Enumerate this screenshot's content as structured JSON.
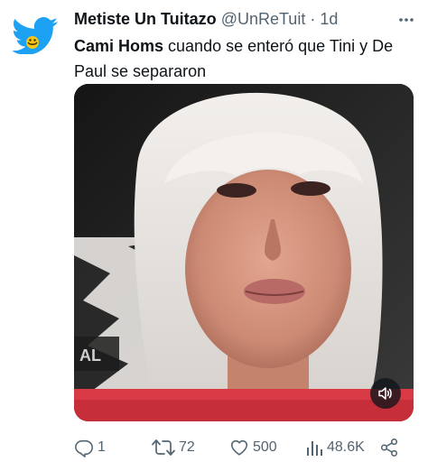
{
  "tweet": {
    "author_name": "Metiste Un Tuitazo",
    "handle": "@UnReTuit",
    "separator": "·",
    "time": "1d",
    "text_bold": "Cami Homs",
    "text_rest": " cuando se enteró que Tini y De Paul se separaron"
  },
  "media": {
    "type": "video"
  },
  "metrics": {
    "replies": "1",
    "retweets": "72",
    "likes": "500",
    "views": "48.6K"
  },
  "icons": {
    "avatar": "twitter-bird-avatar",
    "more": "more-icon",
    "mute": "volume-icon",
    "reply": "reply-icon",
    "retweet": "retweet-icon",
    "like": "heart-icon",
    "views": "views-icon",
    "share": "share-icon"
  },
  "colors": {
    "text": "#0f1419",
    "secondary": "#536471",
    "avatar_blue": "#1da1f2",
    "banner_red": "#d93a46"
  }
}
